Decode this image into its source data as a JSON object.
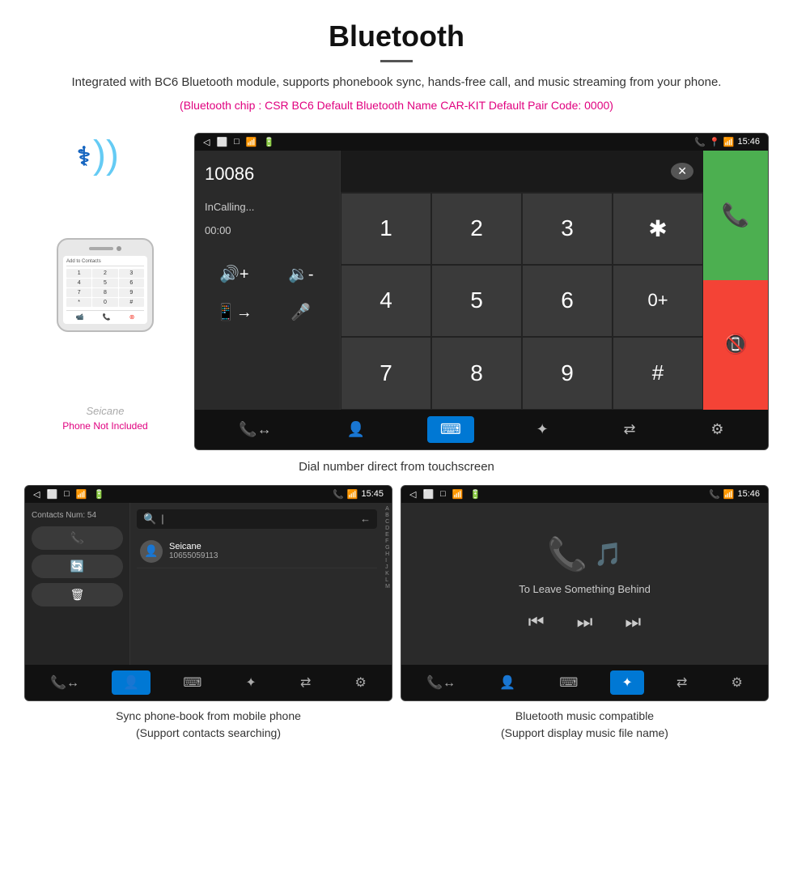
{
  "header": {
    "title": "Bluetooth",
    "description": "Integrated with BC6 Bluetooth module, supports phonebook sync, hands-free call, and music streaming from your phone.",
    "specs": "(Bluetooth chip : CSR BC6    Default Bluetooth Name CAR-KIT    Default Pair Code: 0000)"
  },
  "main_screen": {
    "status_bar": {
      "left_icons": [
        "back-arrow",
        "battery-icon",
        "sim-icon"
      ],
      "right_icons": [
        "phone-icon",
        "location-icon",
        "wifi-icon"
      ],
      "time": "15:46"
    },
    "number_display": "10086",
    "calling_status": "InCalling...",
    "timer": "00:00",
    "dialpad": {
      "keys": [
        "1",
        "2",
        "3",
        "*",
        "4",
        "5",
        "6",
        "0+",
        "7",
        "8",
        "9",
        "#"
      ],
      "green_btn": "📞",
      "red_btn": "📵"
    },
    "bottom_nav": [
      {
        "icon": "phone-transfer-icon",
        "label": "phone-transfer",
        "active": false
      },
      {
        "icon": "contacts-icon",
        "label": "contacts",
        "active": false
      },
      {
        "icon": "dialpad-icon",
        "label": "dialpad",
        "active": true
      },
      {
        "icon": "bluetooth-music-icon",
        "label": "bluetooth-music",
        "active": false
      },
      {
        "icon": "transfer-icon",
        "label": "transfer",
        "active": false
      },
      {
        "icon": "settings-icon",
        "label": "settings",
        "active": false
      }
    ]
  },
  "phone_mockup": {
    "add_contacts_label": "Add to Contacts",
    "keys": [
      "1",
      "2",
      "3",
      "4",
      "5",
      "6",
      "*",
      "0",
      "#"
    ]
  },
  "phone_not_included": "Phone Not Included",
  "seicane_watermark": "Seicane",
  "main_caption": "Dial number direct from touchscreen",
  "contacts_screen": {
    "status_time": "15:45",
    "contacts_num": "Contacts Num: 54",
    "actions": [
      "phone",
      "sync",
      "delete"
    ],
    "search_placeholder": "🔍  |",
    "back_icon": "←",
    "contact": {
      "name": "Seicane",
      "phone": "10655059113",
      "avatar": "👤"
    },
    "alphabet": [
      "A",
      "B",
      "C",
      "D",
      "E",
      "F",
      "G",
      "H",
      "I",
      "J",
      "K",
      "L",
      "M"
    ],
    "bottom_nav_active": "contacts"
  },
  "contacts_caption": "Sync phone-book from mobile phone\n(Support contacts searching)",
  "music_screen": {
    "status_time": "15:46",
    "song_title": "To Leave Something Behind",
    "controls": [
      "prev",
      "play-pause",
      "next"
    ],
    "bottom_nav_active": "bluetooth-music"
  },
  "music_caption": "Bluetooth music compatible\n(Support display music file name)"
}
